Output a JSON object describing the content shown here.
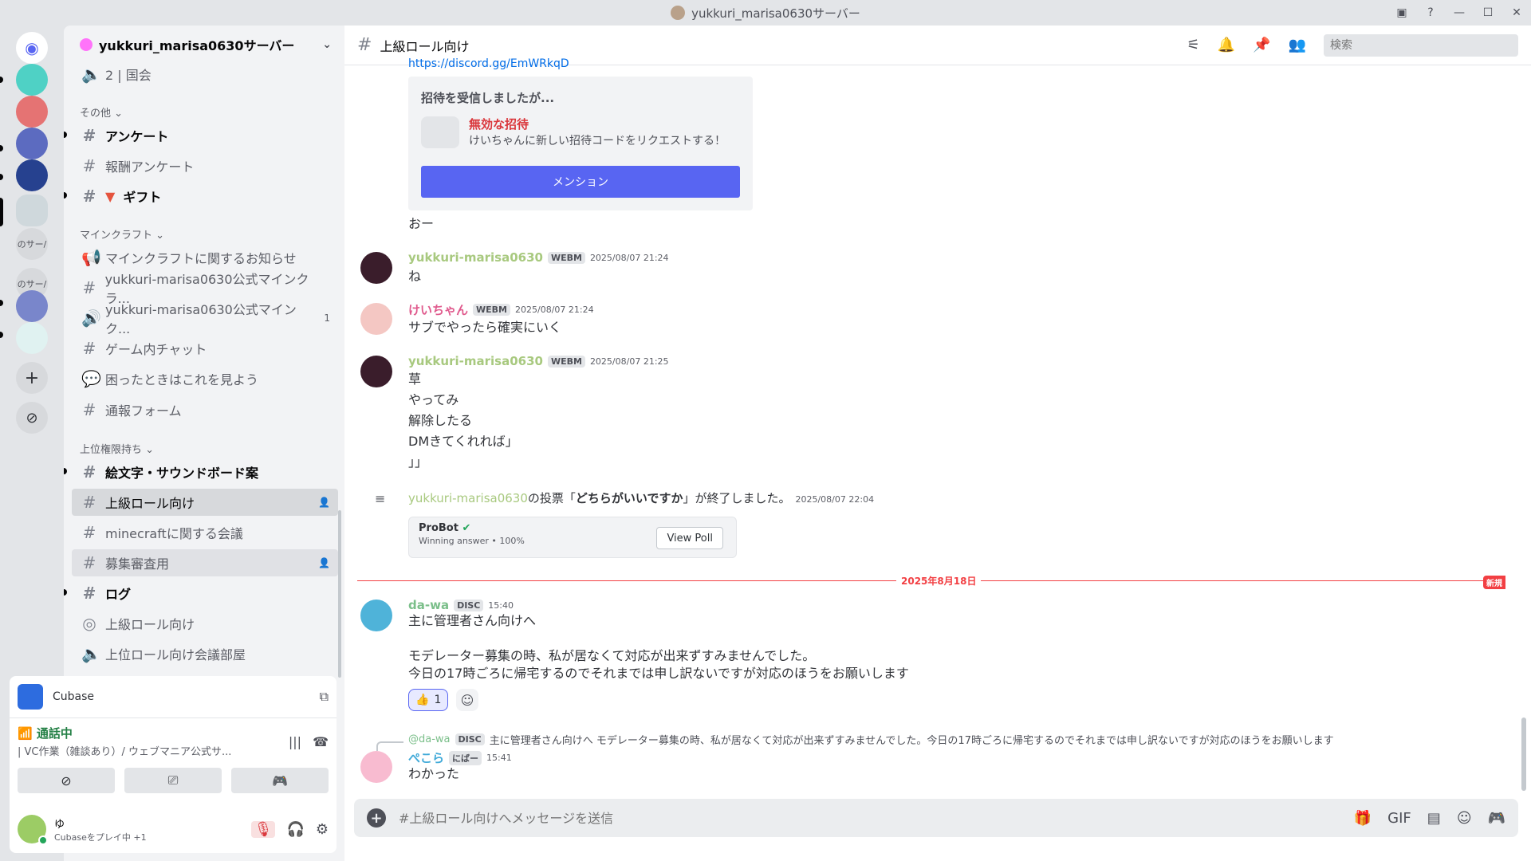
{
  "window": {
    "title": "yukkuri_marisa0630サーバー"
  },
  "rail": {
    "labels": [
      "のサー/",
      "のサー/"
    ]
  },
  "server": {
    "name": "yukkuri_marisa0630サーバー"
  },
  "channels": {
    "top_item": "2 | 国会",
    "cat_other": "その他 ⌄",
    "anketo": "アンケート",
    "housyu": "報酬アンケート",
    "gift": "ギフト",
    "cat_minecraft": "マインクラフト ⌄",
    "mc_news": "マインクラフトに関するお知らせ",
    "mc_official1": "yukkuri-marisa0630公式マインクラ...",
    "mc_official2": "yukkuri-marisa0630公式マインク...",
    "mc_official2_count": "1",
    "ingame_chat": "ゲーム内チャット",
    "trouble": "困ったときはこれを見よう",
    "report": "通報フォーム",
    "cat_upper": "上位権限持ち ⌄",
    "emoji": "絵文字・サウンドボード案",
    "upper_role": "上級ロール向け",
    "mc_meeting": "minecraftに関する会議",
    "recruit": "募集審査用",
    "log": "ログ",
    "upper_role_forum": "上級ロール向け",
    "upper_meeting": "上位ロール向け会議部屋"
  },
  "activity": {
    "app": "Cubase"
  },
  "voice": {
    "status": "通話中",
    "channel": "| VC作業（雑談あり）/ ウェブマニア公式サ..."
  },
  "user": {
    "name": "ゆ",
    "activity": "Cubaseをプレイ中 +1"
  },
  "header": {
    "channel": "上級ロール向け",
    "search_placeholder": "検索"
  },
  "messages": {
    "link": "https://discord.gg/EmWRkqD",
    "invite": {
      "heading": "招待を受信しましたが...",
      "invalid": "無効な招待",
      "sub": "けいちゃんに新しい招待コードをリクエストする！",
      "button": "メンション"
    },
    "oo": "おー",
    "m1": {
      "user": "yukkuri-marisa0630",
      "tag": "WEBM",
      "time": "2025/08/07 21:24",
      "text": "ね"
    },
    "m2": {
      "user": "けいちゃん",
      "tag": "WEBM",
      "time": "2025/08/07 21:24",
      "text": "サブでやったら確実にいく"
    },
    "m3": {
      "user": "yukkuri-marisa0630",
      "tag": "WEBM",
      "time": "2025/08/07 21:25",
      "lines": [
        "草",
        "やってみ",
        "解除したる",
        "DMきてくれれば」",
        "」」"
      ]
    },
    "poll": {
      "user": "yukkuri-marisa0630",
      "pre": "の投票「",
      "question": "どちらがいいですか",
      "post": "」が終了しました。",
      "time": "2025/08/07 22:04",
      "bot": "ProBot",
      "winning": "Winning answer • 100%",
      "view": "View Poll"
    },
    "divider": "2025年8月18日",
    "new_badge": "新規",
    "m4": {
      "user": "da-wa",
      "tag": "DISC",
      "time": "15:40",
      "lines": [
        "主に管理者さん向けへ",
        "",
        "モデレーター募集の時、私が居なくて対応が出来ずすみませんでした。",
        "今日の17時ごろに帰宅するのでそれまでは申し訳ないですが対応のほうをお願いします"
      ],
      "reaction_count": "1"
    },
    "reply": {
      "user": "@da-wa",
      "tag": "DISC",
      "text": "主に管理者さん向けへ モデレーター募集の時、私が居なくて対応が出来ずすみませんでした。今日の17時ごろに帰宅するのでそれまでは申し訳ないですが対応のほうをお願いします"
    },
    "m5": {
      "user": "ぺこら",
      "tag": "にばー",
      "time": "15:41",
      "text": "わかった"
    }
  },
  "composer": {
    "placeholder": "#上級ロール向けへメッセージを送信"
  },
  "colors": {
    "accent": "#5865f2",
    "danger": "#f23f43",
    "green": "#23a55a"
  }
}
